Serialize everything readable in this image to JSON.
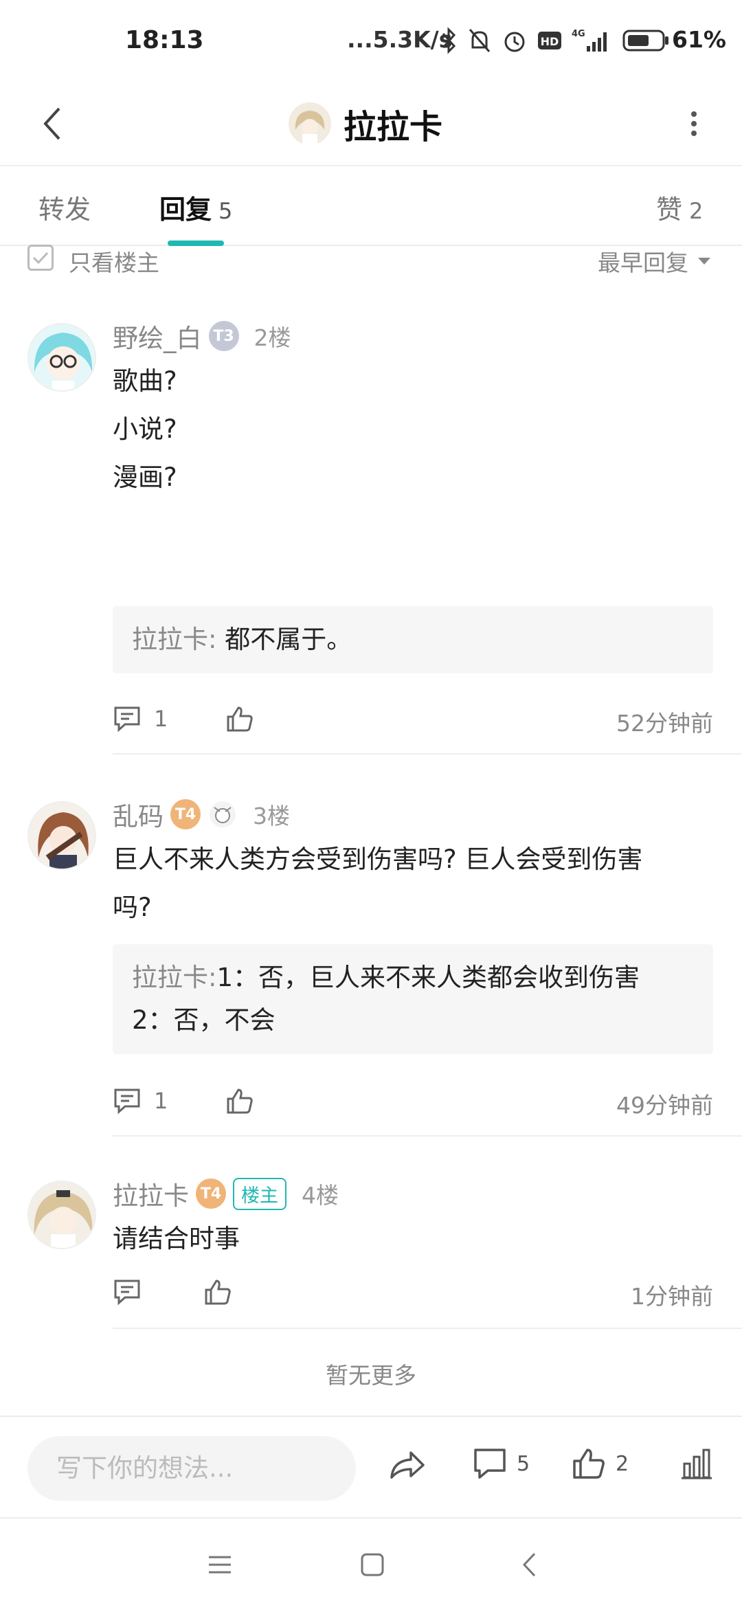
{
  "status_bar": {
    "time": "18:13",
    "net_speed": "...5.3K/s",
    "icons": [
      "bluetooth-icon",
      "mute-icon",
      "alarm-icon",
      "hd-icon",
      "signal-4g-icon",
      "battery-icon"
    ],
    "battery": "61%"
  },
  "header": {
    "title": "拉拉卡",
    "avatar_icon": "avatar-image",
    "back_icon": "chevron-left-icon",
    "more_icon": "more-vertical-icon"
  },
  "tabs": {
    "forward": "转发",
    "reply": "回复",
    "reply_count": "5",
    "like": "赞",
    "like_count": "2",
    "accent_color": "#1fb8b3"
  },
  "filter": {
    "only_op": "只看楼主",
    "sort": "最早回复"
  },
  "posts": [
    {
      "user": "野绘_白",
      "level": "T3",
      "floor": "2楼",
      "lines": [
        "歌曲?",
        "小说?",
        "漫画?"
      ],
      "reply": {
        "name": "拉拉卡",
        "sep": ":",
        "text": "都不属于。"
      },
      "comments": "1",
      "time": "52分钟前"
    },
    {
      "user": "乱码",
      "level": "T4",
      "floor": "3楼",
      "lines": [
        "巨人不来人类方会受到伤害吗? 巨人会受到伤害",
        "吗?"
      ],
      "reply": {
        "name": "拉拉卡",
        "sep": ":",
        "text": "1：否，巨人来不来人类都会收到伤害",
        "text2": "2：否，不会"
      },
      "comments": "1",
      "time": "49分钟前"
    },
    {
      "user": "拉拉卡",
      "level": "T4",
      "op_badge": "楼主",
      "floor": "4楼",
      "lines": [
        "请结合时事"
      ],
      "time": "1分钟前"
    }
  ],
  "no_more": "暂无更多",
  "bottom_bar": {
    "placeholder": "写下你的想法...",
    "comment_count": "5",
    "like_count": "2"
  }
}
